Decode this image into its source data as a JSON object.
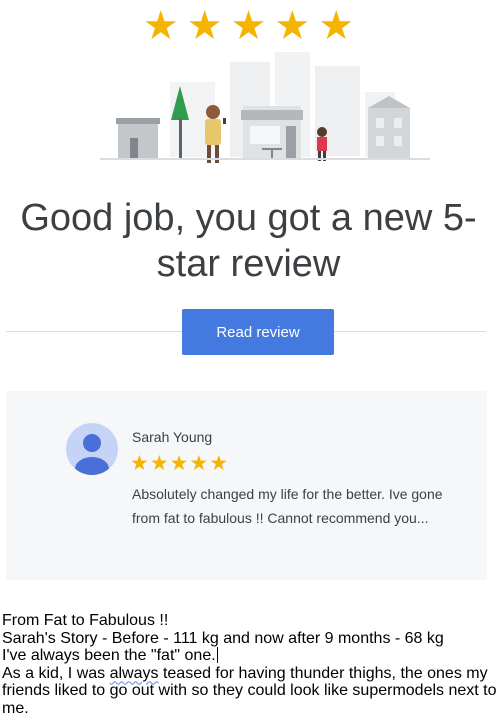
{
  "email": {
    "star_glyph": "★",
    "star_count": 5,
    "star_color": "#f5b400",
    "illustration_icon": "storefront-street-scene-illustration",
    "headline": "Good job, you got a new 5-star review",
    "cta_label": "Read review",
    "cta_color": "#4479e0"
  },
  "review": {
    "reviewer_name": "Sarah Young",
    "rating": 5,
    "text": "Absolutely changed my life for the better. Ive gone from fat to fabulous !! Cannot recommend you..."
  },
  "story": {
    "title": "From Fat to Fabulous !!",
    "line2": "Sarah's Story - Before - 111 kg  and now after 9 months - 68 kg",
    "line3": "I've always been the \"fat\" one.",
    "line4_before": "As a kid, I was ",
    "line4_underlined": "always",
    "line4_after": " teased for having thunder thighs, the ones my friends liked to go out with so they could look like supermodels next to me."
  }
}
